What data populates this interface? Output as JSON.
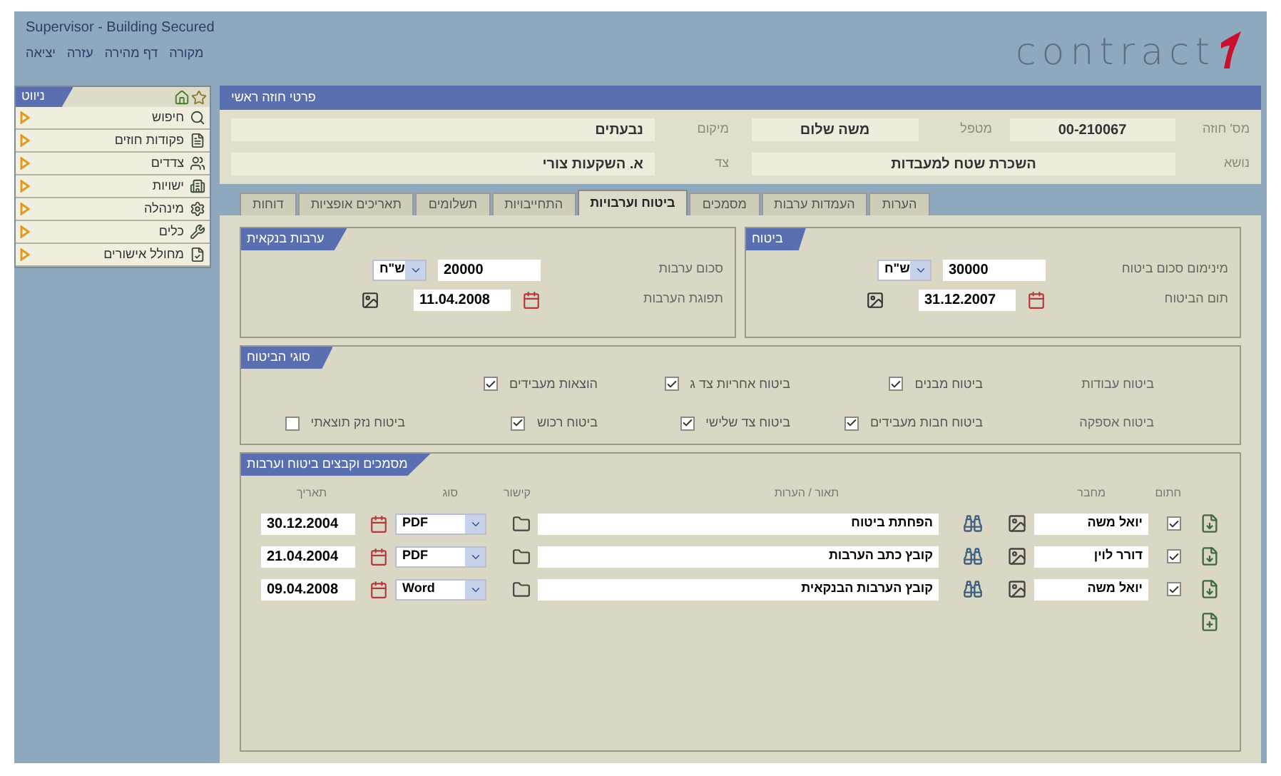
{
  "window": {
    "title": "Supervisor - Building Secured"
  },
  "menu": [
    "מקורה",
    "דף מהירה",
    "עזרה",
    "יציאה"
  ],
  "logo": "contract",
  "sidebar": {
    "title": "ניווט",
    "items": [
      "חיפוש",
      "פקודות חוזים",
      "צדדים",
      "ישויות",
      "מינהלה",
      "כלים",
      "מחולל אישורים"
    ]
  },
  "header": {
    "title": "פרטי חוזה ראשי",
    "right_rows": [
      [
        {
          "label": "מס' חוזה",
          "value": "00-210067"
        },
        {
          "label": "מטפל",
          "value": "משה שלום"
        }
      ],
      [
        {
          "label": "נושא",
          "value": "השכרת שטח למעבדות"
        }
      ]
    ],
    "left_rows": [
      {
        "label": "מיקום",
        "value": "נבעתים"
      },
      {
        "label": "צד",
        "value": "א. השקעות צורי"
      }
    ]
  },
  "tabs": [
    {
      "label": "הערות",
      "selected": false
    },
    {
      "label": "העמדות ערבות",
      "selected": false
    },
    {
      "label": "מסמכים",
      "selected": false
    },
    {
      "label": "ביטוח וערבויות",
      "selected": true
    },
    {
      "label": "התחייבויות",
      "selected": false
    },
    {
      "label": "תשלומים",
      "selected": false
    },
    {
      "label": "תאריכים אופציות",
      "selected": false
    },
    {
      "label": "דוחות",
      "selected": false
    }
  ],
  "money_groups": [
    {
      "title": "ביטוח",
      "amount_label": "מינימום סכום ביטוח",
      "amount": "30000",
      "currency": "ש\"ח",
      "date_label": "תום הביטוח",
      "date": "31.12.2007"
    },
    {
      "title": "ערבות בנקאית",
      "amount_label": "סכום ערבות",
      "amount": "20000",
      "currency": "ש\"ח",
      "date_label": "תפוגת הערבות",
      "date": "11.04.2008"
    }
  ],
  "insurance_types": {
    "title": "סוגי הביטוח",
    "rows": [
      {
        "label": "ביטוח עבודות",
        "options": [
          {
            "label": "ביטוח מבנים",
            "checked": true
          },
          {
            "label": "ביטוח אחריות צד ג",
            "checked": true
          },
          {
            "label": "הוצאות מעבידים",
            "checked": true
          }
        ]
      },
      {
        "label": "ביטוח אספקה",
        "options": [
          {
            "label": "ביטוח חבות מעבידים",
            "checked": true
          },
          {
            "label": "ביטוח צד שלישי",
            "checked": true
          },
          {
            "label": "ביטוח רכוש",
            "checked": true
          },
          {
            "label": "ביטוח נזק תוצאתי",
            "checked": false
          }
        ]
      }
    ]
  },
  "documents": {
    "title": "מסמכים וקבצים ביטוח וערבות",
    "columns": {
      "signed": "חתום",
      "author": "מחבר",
      "description": "תאור / הערות",
      "link": "קישור",
      "type": "סוג",
      "date": "תאריך"
    },
    "rows": [
      {
        "checked": true,
        "author": "יואל משה",
        "description": "הפחתת ביטוח",
        "type": "PDF",
        "date": "30.12.2004"
      },
      {
        "checked": true,
        "author": "דורר לוין",
        "description": "קובץ כתב הערבות",
        "type": "PDF",
        "date": "21.04.2004"
      },
      {
        "checked": true,
        "author": "יואל משה",
        "description": "קובץ הערבות הבנקאית",
        "type": "Word",
        "date": "09.04.2008"
      }
    ]
  }
}
